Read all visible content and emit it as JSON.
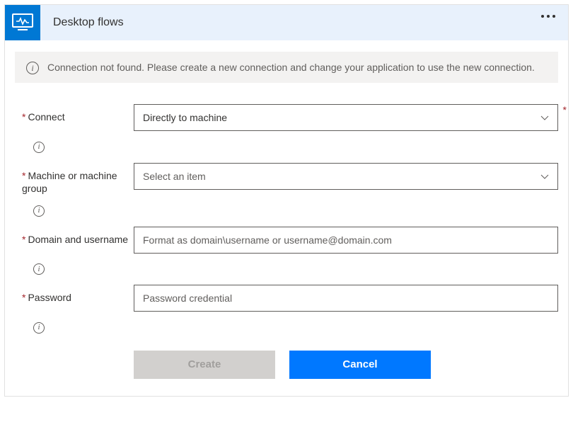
{
  "header": {
    "title": "Desktop flows"
  },
  "alert": {
    "text": "Connection not found. Please create a new connection and change your application to use the new connection."
  },
  "form": {
    "connect": {
      "label": "Connect",
      "value": "Directly to machine"
    },
    "machine": {
      "label": "Machine or machine group",
      "placeholder": "Select an item"
    },
    "domain": {
      "label": "Domain and username",
      "placeholder": "Format as domain\\username or username@domain.com"
    },
    "password": {
      "label": "Password",
      "placeholder": "Password credential"
    }
  },
  "buttons": {
    "create": "Create",
    "cancel": "Cancel"
  }
}
